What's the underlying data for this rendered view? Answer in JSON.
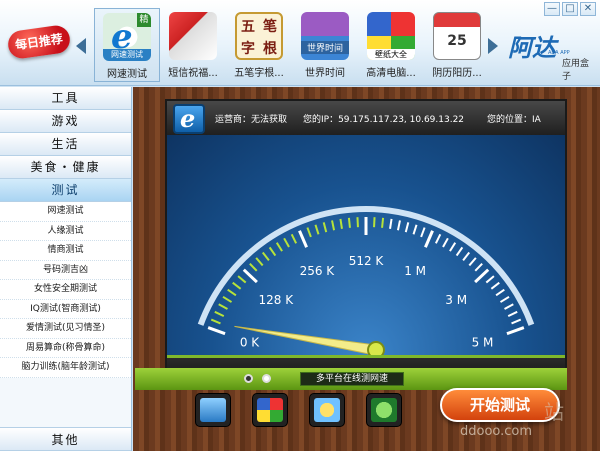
{
  "window": {
    "controls": [
      "—",
      "□",
      "✕"
    ]
  },
  "header": {
    "daily_badge": "每日推荐",
    "apps": [
      {
        "label": "网速测试",
        "icon": "speedtest-icon",
        "tile_text": "网速测试",
        "tag": "精",
        "selected": true
      },
      {
        "label": "短信祝福...",
        "icon": "sms-icon",
        "selected": false
      },
      {
        "label": "五笔字根...",
        "icon": "wubi-icon",
        "tile_chars": [
          "五",
          "笔",
          "字",
          "根"
        ],
        "selected": false
      },
      {
        "label": "世界时间",
        "icon": "world-time-icon",
        "tile_text": "世界时间",
        "selected": false
      },
      {
        "label": "高清电脑...",
        "icon": "cube-icon",
        "tile_text": "壁纸大全",
        "selected": false
      },
      {
        "label": "阴历阳历...",
        "icon": "calendar-icon",
        "tile_text": "25",
        "selected": false
      }
    ],
    "brand": {
      "name": "阿达",
      "sub": "应用盒子",
      "tiny": "ADA APP"
    }
  },
  "sidebar": {
    "categories": [
      "工具",
      "游戏",
      "生活",
      "美食・健康"
    ],
    "active": "测试",
    "items": [
      "网速测试",
      "人缘测试",
      "情商测试",
      "号码测吉凶",
      "女性安全期测试",
      "IQ测试(智商测试)",
      "爱情测试(见习情圣)",
      "周易算命(称骨算命)",
      "脑力训练(脑年龄测试)"
    ],
    "bottom": "其他"
  },
  "speedtest": {
    "operator": "运营商：无法获取",
    "ip": "您的IP：59.175.117.23, 10.69.13.22",
    "location": "您的位置：IA",
    "gauge_labels": [
      "0 K",
      "128 K",
      "256 K",
      "512 K",
      "1 M",
      "3 M",
      "5 M"
    ],
    "current_reading_fraction": 0.0,
    "platform_label": "多平台在线测网速",
    "start_button": "开始测试",
    "watermark": "ddooo.com",
    "watermark_chars": "站"
  },
  "colors": {
    "accent": "#7fb82b",
    "start": "#e65a1e",
    "gauge": "#1a5a9c"
  }
}
